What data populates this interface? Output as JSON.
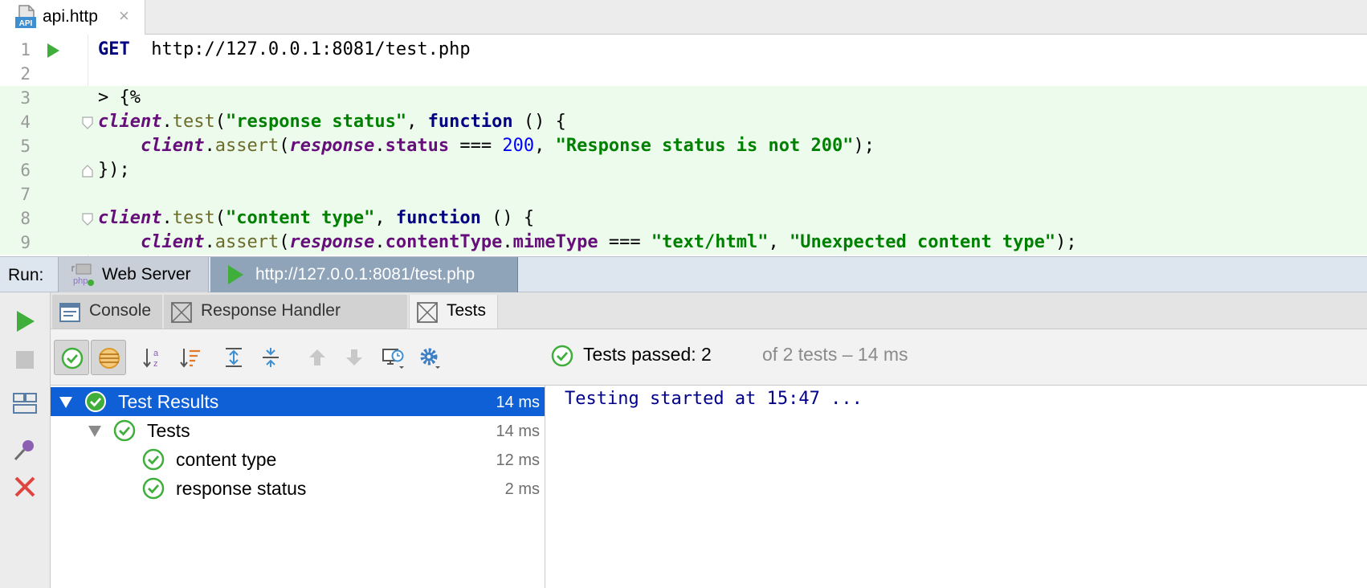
{
  "editor_tab": {
    "icon_text": "API",
    "filename": "api.http",
    "close_symbol": "×"
  },
  "editor": {
    "lines": [
      {
        "n": "1",
        "parts": [
          [
            "kw",
            "GET"
          ],
          [
            "",
            "  http://127.0.0.1:8081/test.php"
          ]
        ]
      },
      {
        "n": "2",
        "parts": []
      },
      {
        "n": "3",
        "parts": [
          [
            "",
            "> {%"
          ]
        ]
      },
      {
        "n": "4",
        "parts": [
          [
            "it",
            "client"
          ],
          [
            "",
            "."
          ],
          [
            "fn",
            "test"
          ],
          [
            "",
            "("
          ],
          [
            "st",
            "\"response status\""
          ],
          [
            "",
            ", "
          ],
          [
            "kw",
            "function"
          ],
          [
            "",
            " () {"
          ]
        ]
      },
      {
        "n": "5",
        "parts": [
          [
            "",
            "    "
          ],
          [
            "it",
            "client"
          ],
          [
            "",
            "."
          ],
          [
            "fn",
            "assert"
          ],
          [
            "",
            "("
          ],
          [
            "it",
            "response"
          ],
          [
            "",
            "."
          ],
          [
            "pr",
            "status"
          ],
          [
            "",
            " === "
          ],
          [
            "nm",
            "200"
          ],
          [
            "",
            ", "
          ],
          [
            "st",
            "\"Response status is not 200\""
          ],
          [
            "",
            ");"
          ]
        ]
      },
      {
        "n": "6",
        "parts": [
          [
            "",
            "});"
          ]
        ]
      },
      {
        "n": "7",
        "parts": []
      },
      {
        "n": "8",
        "parts": [
          [
            "it",
            "client"
          ],
          [
            "",
            "."
          ],
          [
            "fn",
            "test"
          ],
          [
            "",
            "("
          ],
          [
            "st",
            "\"content type\""
          ],
          [
            "",
            ", "
          ],
          [
            "kw",
            "function"
          ],
          [
            "",
            " () {"
          ]
        ]
      },
      {
        "n": "9",
        "parts": [
          [
            "",
            "    "
          ],
          [
            "it",
            "client"
          ],
          [
            "",
            "."
          ],
          [
            "fn",
            "assert"
          ],
          [
            "",
            "("
          ],
          [
            "it",
            "response"
          ],
          [
            "",
            "."
          ],
          [
            "pr",
            "contentType"
          ],
          [
            "",
            "."
          ],
          [
            "pr",
            "mimeType"
          ],
          [
            "",
            " === "
          ],
          [
            "st",
            "\"text/html\""
          ],
          [
            "",
            ", "
          ],
          [
            "st",
            "\"Unexpected content type\""
          ],
          [
            "",
            ");"
          ]
        ]
      }
    ]
  },
  "run_bar": {
    "label": "Run:",
    "tabs": [
      {
        "label": "Web Server",
        "icon_text": "php"
      },
      {
        "label": "http://127.0.0.1:8081/test.php"
      }
    ]
  },
  "sub_tabs": {
    "console": "Console",
    "response_handler": "Response Handler",
    "tests": "Tests"
  },
  "test_status": {
    "passed_text": "Tests passed: 2",
    "detail_text": "of 2 tests – 14 ms"
  },
  "tree": [
    {
      "label": "Test Results",
      "duration": "14 ms"
    },
    {
      "label": "Tests",
      "duration": "14 ms"
    },
    {
      "label": "content type",
      "duration": "12 ms"
    },
    {
      "label": "response status",
      "duration": "2 ms"
    }
  ],
  "output": {
    "message": "Testing started at 15:47 ..."
  },
  "colors": {
    "selection": "#0f5fd6",
    "pass_green": "#3fae3a",
    "keyword": "#000080",
    "string": "#008000",
    "injected_bg": "#edfbed"
  }
}
